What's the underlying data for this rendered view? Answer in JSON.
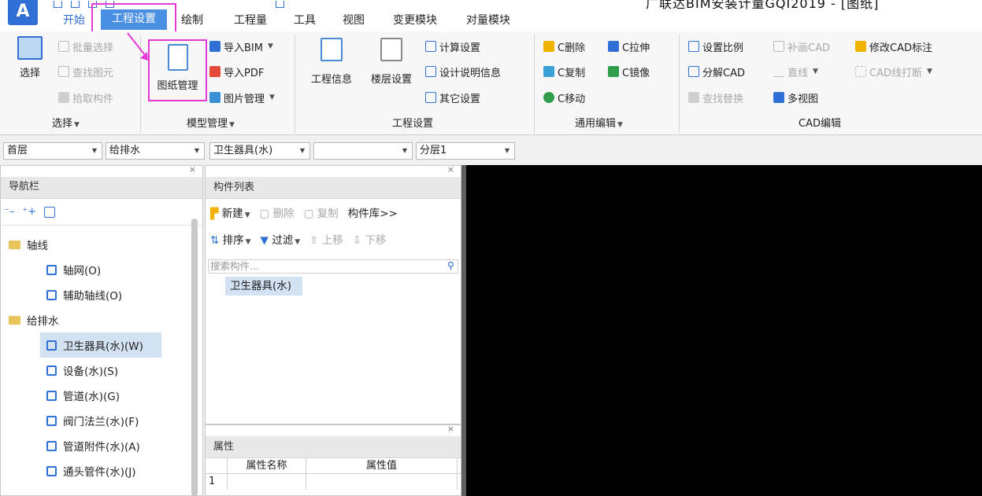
{
  "app": {
    "logo_letter": "A",
    "window_title": "广联达BIM安装计量GQI2019 - [图纸]"
  },
  "menu_tabs": [
    "开始",
    "工程设置",
    "绘制",
    "工程量",
    "工具",
    "视图",
    "变更模块",
    "对量模块"
  ],
  "ribbon": {
    "select_group": {
      "big": "选择",
      "items": [
        "批量选择",
        "查找图元",
        "拾取构件"
      ],
      "label": "选择"
    },
    "model_group": {
      "big": "图纸管理",
      "items": [
        "导入BIM",
        "导入PDF",
        "图片管理"
      ],
      "label": "模型管理"
    },
    "project_group": {
      "project_info": "工程信息",
      "floor_settings": "楼层设置",
      "items": [
        "计算设置",
        "设计说明信息",
        "其它设置"
      ],
      "label": "工程设置"
    },
    "edit_group": {
      "items": [
        "C删除",
        "C拉伸",
        "C复制",
        "C镜像",
        "C移动"
      ],
      "label": "通用编辑"
    },
    "cad_group": {
      "items": [
        "设置比例",
        "补画CAD",
        "修改CAD标注",
        "分解CAD",
        "直线",
        "CAD线打断",
        "查找替换",
        "多视图"
      ],
      "label": "CAD编辑"
    }
  },
  "selectors": [
    "首层",
    "给排水",
    "卫生器具(水)",
    "",
    "分层1"
  ],
  "nav": {
    "title": "导航栏",
    "tree": [
      {
        "label": "轴线",
        "type": "folder"
      },
      {
        "label": "轴网(O)",
        "type": "leaf",
        "icon": "grid-icon",
        "color": "#2f6fd6"
      },
      {
        "label": "辅助轴线(O)",
        "type": "leaf",
        "icon": "aux-axis-icon",
        "color": "#2f6fd6"
      },
      {
        "label": "给排水",
        "type": "folder"
      },
      {
        "label": "卫生器具(水)(W)",
        "type": "leaf",
        "icon": "sanitary-icon",
        "color": "#2f6fd6",
        "selected": true
      },
      {
        "label": "设备(水)(S)",
        "type": "leaf",
        "icon": "equipment-icon",
        "color": "#2f6fd6"
      },
      {
        "label": "管道(水)(G)",
        "type": "leaf",
        "icon": "pipe-icon",
        "color": "#2f6fd6"
      },
      {
        "label": "阀门法兰(水)(F)",
        "type": "leaf",
        "icon": "valve-icon",
        "color": "#2f6fd6"
      },
      {
        "label": "管道附件(水)(A)",
        "type": "leaf",
        "icon": "pipe-accessory-icon",
        "color": "#2f6fd6"
      },
      {
        "label": "通头管件(水)(J)",
        "type": "leaf",
        "icon": "fitting-icon",
        "color": "#2f6fd6"
      }
    ]
  },
  "component_list": {
    "title": "构件列表",
    "toolbar1": [
      "新建",
      "删除",
      "复制",
      "构件库>>"
    ],
    "toolbar2": [
      "排序",
      "过滤",
      "上移",
      "下移"
    ],
    "search_placeholder": "搜索构件...",
    "items": [
      "卫生器具(水)"
    ]
  },
  "properties": {
    "title": "属性",
    "col_name": "属性名称",
    "col_value": "属性值",
    "row1": "1"
  }
}
